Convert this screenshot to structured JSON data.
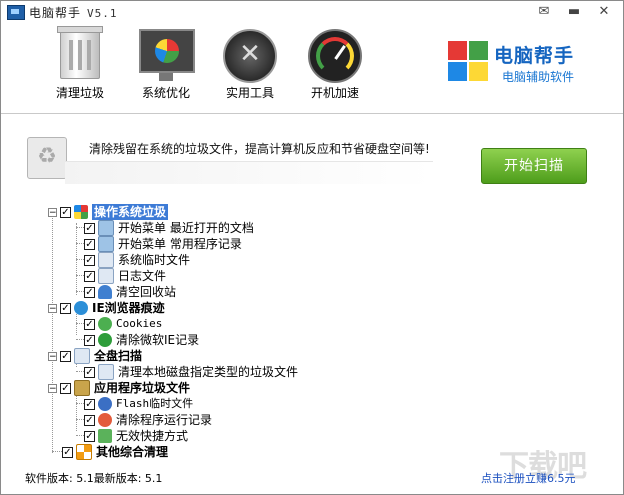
{
  "window": {
    "title": "电脑帮手",
    "version": "V5.1"
  },
  "toolbar": {
    "items": [
      {
        "label": "清理垃圾",
        "icon": "trash-icon"
      },
      {
        "label": "系统优化",
        "icon": "monitor-icon"
      },
      {
        "label": "实用工具",
        "icon": "tools-icon"
      },
      {
        "label": "开机加速",
        "icon": "gauge-icon"
      }
    ]
  },
  "logo": {
    "name": "电脑帮手",
    "subtitle": "电脑辅助软件"
  },
  "info": {
    "message": "清除残留在系统的垃圾文件，提高计算机反应和节省硬盘空间等!",
    "scan_button": "开始扫描"
  },
  "tree": {
    "categories": [
      {
        "label": "操作系统垃圾",
        "selected": true,
        "children": [
          {
            "label": "开始菜单 最近打开的文档"
          },
          {
            "label": "开始菜单 常用程序记录"
          },
          {
            "label": "系统临时文件"
          },
          {
            "label": "日志文件"
          },
          {
            "label": "清空回收站"
          }
        ]
      },
      {
        "label": "IE浏览器痕迹",
        "children": [
          {
            "label": "Cookies"
          },
          {
            "label": "清除微软IE记录"
          }
        ]
      },
      {
        "label": "全盘扫描",
        "children": [
          {
            "label": "清理本地磁盘指定类型的垃圾文件"
          }
        ]
      },
      {
        "label": "应用程序垃圾文件",
        "children": [
          {
            "label": "Flash临时文件"
          },
          {
            "label": "清除程序运行记录"
          },
          {
            "label": "无效快捷方式"
          }
        ]
      },
      {
        "label": "其他综合清理",
        "children": []
      }
    ]
  },
  "footer": {
    "version_label": "软件版本: 5.1最新版本: 5.1",
    "register_link": "点击注册立赚6.5元"
  },
  "watermark": "下载吧",
  "colors": {
    "accent": "#3d7bd6",
    "scan_green": "#5aa822",
    "logo_blue": "#1565c0"
  }
}
